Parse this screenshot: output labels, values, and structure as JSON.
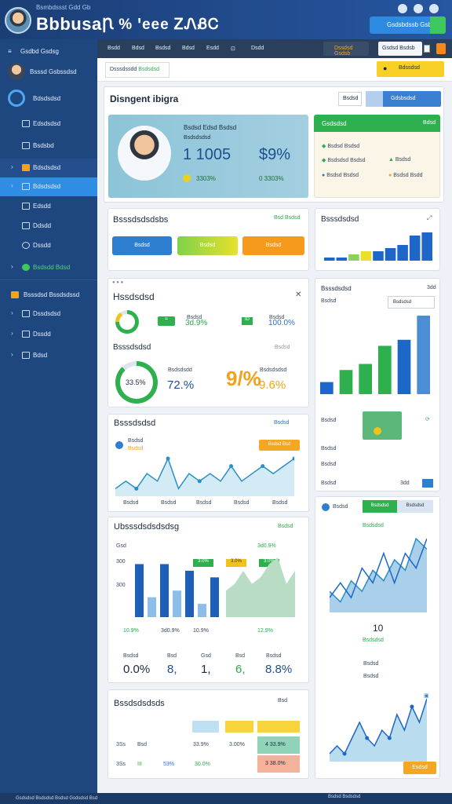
{
  "header": {
    "brand": "Bbbusa",
    "brand_sub": "Bsmbdssst Gdd Gb",
    "mid": "Ꞃ % ꞌeee ᏃᏁᏰᏟ",
    "btn": "Gsdsbdssb Gsb",
    "colors": {
      "accent": "#2e8ae0",
      "green": "#3ec95e"
    }
  },
  "sidebar": {
    "user": "Bsssd Gsbssdsd",
    "items": [
      {
        "label": "Gsdbd Gsdsg"
      },
      {
        "label": "Bdsdsdsd"
      },
      {
        "label": "Edsdsdsd"
      },
      {
        "label": "Bsdsbd",
        "active": false
      },
      {
        "label": "Bdsdsdsd",
        "active": true
      },
      {
        "label": "Edsdd"
      },
      {
        "label": "Ddsdd"
      },
      {
        "label": "Dssdd"
      },
      {
        "label": "Bsdsdd Bdsd"
      }
    ],
    "section": "Bsssdsd Bssdsdssd",
    "sub": [
      "Dssdsdsd",
      "Dssdd",
      "Bdsd"
    ]
  },
  "topnav": {
    "items": [
      "Bsdd",
      "Bdsd",
      "Bsdsd",
      "Bdsd",
      "Esdd",
      "Dsdd"
    ],
    "select1": "Dssdsd Gsdsb",
    "select2": "Gsdsd Bsdsb"
  },
  "subbar": {
    "crumb_a": "Dsssdssdd",
    "crumb_b": "Bsdsdsd",
    "action": "Bdssdsd"
  },
  "profile": {
    "title": "Disngent ibigra",
    "pager": "Bsdsd",
    "tab": "Gdsbsdsd",
    "heading": "Bsdsd Edsd Bsdsd",
    "sub": "Bsdsdsdsd",
    "big_a": "1 1005",
    "big_b": "$9%",
    "foot_a": "3303%",
    "foot_b": "0 3303%"
  },
  "status": {
    "title": "Gsdsdsd",
    "rows": [
      [
        "Bsdsd Bsdsd",
        "Bdsd"
      ],
      [
        "Bsdsdsd Bsdsd",
        "Bsdsd"
      ],
      [
        "Bsdsd Bsdsd",
        "Bsdsd Bsdd"
      ]
    ]
  },
  "range": {
    "title": "Bsssdsdsdsbs",
    "link": "Bsd Bsdsd",
    "buttons": [
      "Bsdsd",
      "Bsdsd",
      "Bsdsd"
    ]
  },
  "revenue": {
    "title": "Bsssdsdsd"
  },
  "metrics": {
    "title": "Hssdsdsd",
    "a_lbl": "Bsdsd",
    "a_val": "3d.9%",
    "b_lbl": "Bsdsd",
    "b_val": "100.0%",
    "stat_title": "Bsssdsdsd",
    "ring_val": "33.5%",
    "mid_lbl": "Bsdsdsdd",
    "mid_val": "72.%",
    "big_glyph": "9/%",
    "right_lbl": "Bsdsdsdsd",
    "right_val": "9.6%"
  },
  "activity": {
    "title": "Bsssdsdsd",
    "x": [
      "Bsdsd",
      "Bsdsd",
      "Bsdsd",
      "Bsdsd",
      "Bsdsd"
    ],
    "pill": "Bsdsd Bsd",
    "lbl": "Bsdsd",
    "val": "Bsdsd"
  },
  "comparison": {
    "title": "Ubsssdsdsdsdsg",
    "nums": [
      "Gsd",
      "Ssd",
      "300",
      "Ssd",
      "Ssd",
      "Ssd"
    ],
    "bottom": [
      "0.0%",
      "8,",
      "1,",
      "6,",
      "8.8%"
    ],
    "pcts": [
      "10.9%",
      "3d0.9%",
      "10.9%",
      "3.0%",
      "12.9%",
      "10.9%"
    ],
    "lbls": [
      "Bsdsd",
      "Bsd",
      "Gsd",
      "Bsd",
      "Bsdsd"
    ]
  },
  "trend": {
    "title": "Bsssdsdsd",
    "row1": "Bsdsd",
    "row2": "Bsdsd",
    "row3": "Bsdsd",
    "v1": "3dd",
    "tab_a": "Bsdsdsd",
    "tab_b": "Bsdsdsd",
    "val": "10",
    "sub": "Bsdsdsd",
    "peak": "Esdsd Bsdsd"
  },
  "bottom": {
    "title": "Bssdsdsdsds",
    "rows": [
      [
        "3Ss",
        "Bsd",
        "33.9%",
        "3.00%",
        "4 33.9%"
      ],
      [
        "3Ss",
        "III",
        "53%",
        "30.0%",
        "3 38.0%"
      ]
    ],
    "btn": "Esdsd"
  },
  "footer": {
    "left": "Gsdsdsd Bsdsdsd Bsdsd Gsdsdsd Bsd",
    "right": "Bsdsd Bsdsdsd"
  },
  "chart_data": [
    {
      "type": "bar",
      "values": [
        1,
        1,
        2,
        3,
        3,
        4,
        5,
        8,
        9
      ],
      "series": [
        {
          "values": [
            1,
            1,
            2,
            3,
            3,
            4,
            5,
            8,
            9
          ]
        }
      ]
    },
    {
      "type": "bar",
      "values": [
        2,
        4,
        5,
        8,
        9,
        13
      ],
      "series": [
        {
          "values": [
            2,
            4,
            5,
            8,
            9,
            13
          ]
        }
      ]
    },
    {
      "type": "line",
      "values": [
        3,
        4,
        3,
        5,
        4,
        7,
        3,
        5,
        4,
        5,
        4,
        6,
        4,
        5,
        6,
        5,
        6,
        7
      ],
      "series": [
        {
          "values": [
            3,
            4,
            3,
            5,
            4,
            7,
            3,
            5,
            4,
            5,
            4,
            6,
            4,
            5,
            6,
            5,
            6,
            7
          ]
        }
      ]
    },
    {
      "type": "bar",
      "series": [
        {
          "values": [
            8,
            3,
            8,
            4,
            7,
            2,
            6
          ]
        },
        {
          "values": [
            4,
            5,
            7,
            5,
            6,
            8,
            9,
            5,
            7
          ]
        }
      ]
    },
    {
      "type": "area",
      "series": [
        {
          "values": [
            4,
            3,
            5,
            4,
            6,
            5,
            7,
            6,
            9,
            8
          ]
        },
        {
          "values": [
            2,
            3,
            2,
            4,
            3,
            5,
            3,
            5,
            4,
            6
          ]
        }
      ]
    },
    {
      "type": "area",
      "series": [
        {
          "values": [
            3,
            4,
            3,
            5,
            7,
            5,
            4,
            6,
            5,
            8,
            6,
            9,
            7,
            10
          ]
        }
      ]
    }
  ]
}
